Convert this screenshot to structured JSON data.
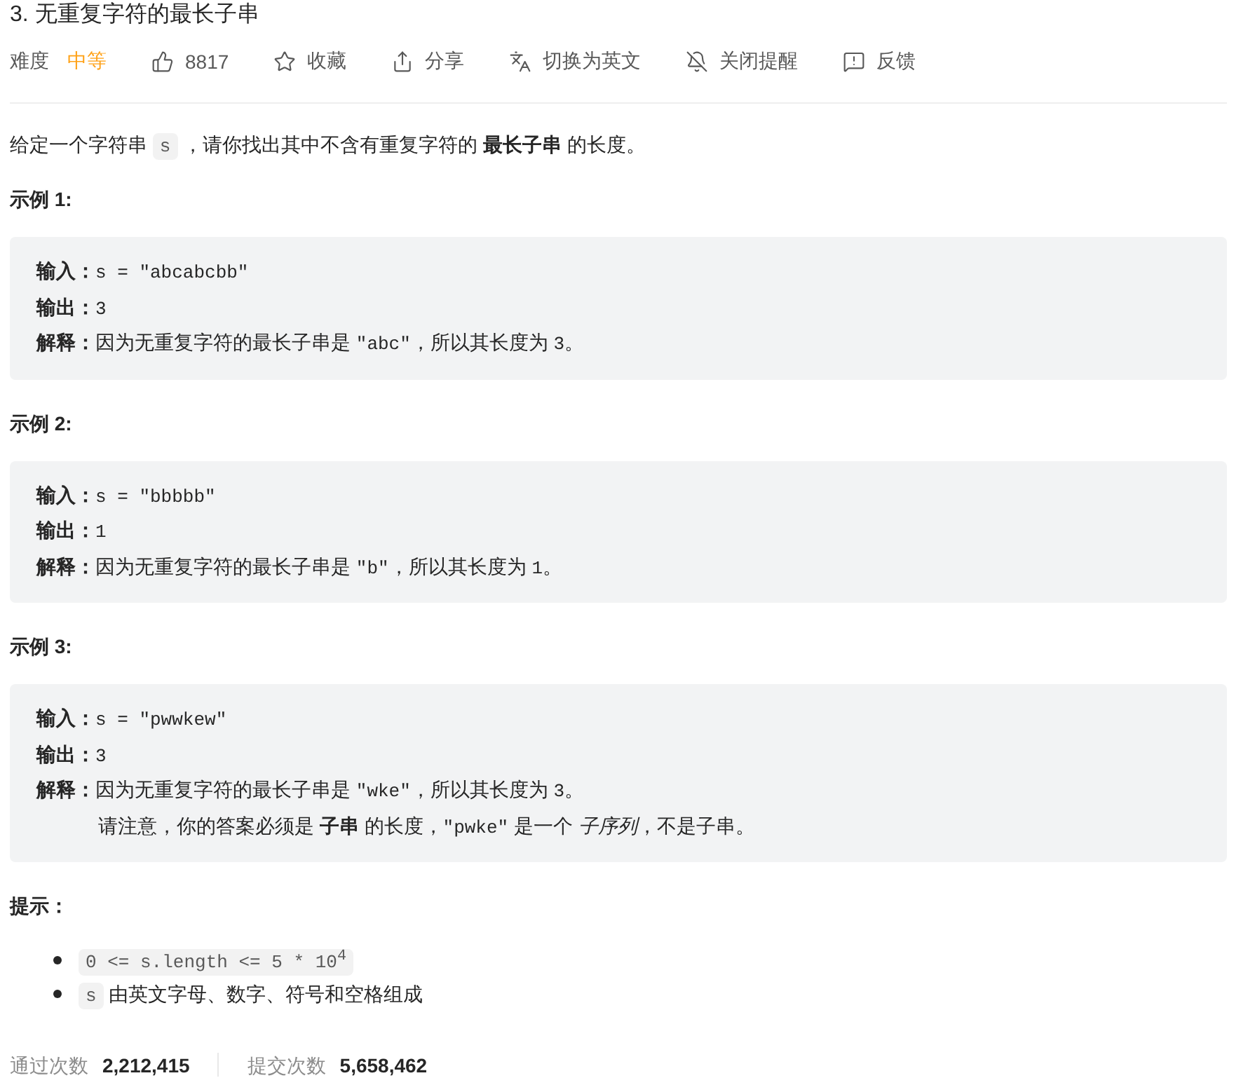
{
  "title": "3. 无重复字符的最长子串",
  "toolbar": {
    "difficulty_label": "难度",
    "difficulty": "中等",
    "actions": [
      {
        "kind": "like",
        "label": "8817"
      },
      {
        "kind": "favorite",
        "label": "收藏"
      },
      {
        "kind": "share",
        "label": "分享"
      },
      {
        "kind": "translate",
        "label": "切换为英文"
      },
      {
        "kind": "reminder",
        "label": "关闭提醒"
      },
      {
        "kind": "feedback",
        "label": "反馈"
      }
    ]
  },
  "description": [
    {
      "kind": "text",
      "text": "给定一个字符串 "
    },
    {
      "kind": "code",
      "text": "s"
    },
    {
      "kind": "text",
      "text": " ，请你找出其中不含有重复字符的 **最长子串** 的长度。"
    }
  ],
  "examples": [
    {
      "title": "示例 1:",
      "lines": [
        {
          "kind": "field",
          "label": "输入：",
          "segments": [
            {
              "kind": "code",
              "text": "s = \"abcabcbb\""
            }
          ]
        },
        {
          "kind": "field",
          "label": "输出：",
          "segments": [
            {
              "kind": "code",
              "text": "3"
            }
          ]
        },
        {
          "kind": "field",
          "label": "解释：",
          "segments": [
            {
              "kind": "text",
              "text": "因为无重复字符的最长子串是 "
            },
            {
              "kind": "code",
              "text": "\"abc\""
            },
            {
              "kind": "text",
              "text": "，所以其长度为 "
            },
            {
              "kind": "code",
              "text": "3"
            },
            {
              "kind": "text",
              "text": "。"
            }
          ]
        }
      ]
    },
    {
      "title": "示例 2:",
      "lines": [
        {
          "kind": "field",
          "label": "输入：",
          "segments": [
            {
              "kind": "code",
              "text": "s = \"bbbbb\""
            }
          ]
        },
        {
          "kind": "field",
          "label": "输出：",
          "segments": [
            {
              "kind": "code",
              "text": "1"
            }
          ]
        },
        {
          "kind": "field",
          "label": "解释：",
          "segments": [
            {
              "kind": "text",
              "text": "因为无重复字符的最长子串是 "
            },
            {
              "kind": "code",
              "text": "\"b\""
            },
            {
              "kind": "text",
              "text": "，所以其长度为 "
            },
            {
              "kind": "code",
              "text": "1"
            },
            {
              "kind": "text",
              "text": "。"
            }
          ]
        }
      ]
    },
    {
      "title": "示例 3:",
      "lines": [
        {
          "kind": "field",
          "label": "输入：",
          "segments": [
            {
              "kind": "code",
              "text": "s = \"pwwkew\""
            }
          ]
        },
        {
          "kind": "field",
          "label": "输出：",
          "segments": [
            {
              "kind": "code",
              "text": "3"
            }
          ]
        },
        {
          "kind": "field",
          "label": "解释：",
          "segments": [
            {
              "kind": "text",
              "text": "因为无重复字符的最长子串是 "
            },
            {
              "kind": "code",
              "text": "\"wke\""
            },
            {
              "kind": "text",
              "text": "，所以其长度为 "
            },
            {
              "kind": "code",
              "text": "3"
            },
            {
              "kind": "text",
              "text": "。"
            }
          ]
        },
        {
          "kind": "note",
          "segments": [
            {
              "kind": "text",
              "text": "请注意，你的答案必须是 **子串** 的长度，"
            },
            {
              "kind": "code",
              "text": "\"pwke\""
            },
            {
              "kind": "text",
              "text": " 是一个 *子序列*，不是子串。"
            }
          ]
        }
      ]
    }
  ],
  "hints": {
    "title": "提示：",
    "items": [
      {
        "segments": [
          {
            "kind": "code",
            "text": "0 <= s.length <= 5 * 10$^{4}$"
          }
        ]
      },
      {
        "segments": [
          {
            "kind": "code",
            "text": "s"
          },
          {
            "kind": "text",
            "text": " 由英文字母、数字、符号和空格组成"
          }
        ]
      }
    ]
  },
  "stats": [
    {
      "label": "通过次数",
      "value": "2,212,415"
    },
    {
      "label": "提交次数",
      "value": "5,658,462"
    }
  ]
}
